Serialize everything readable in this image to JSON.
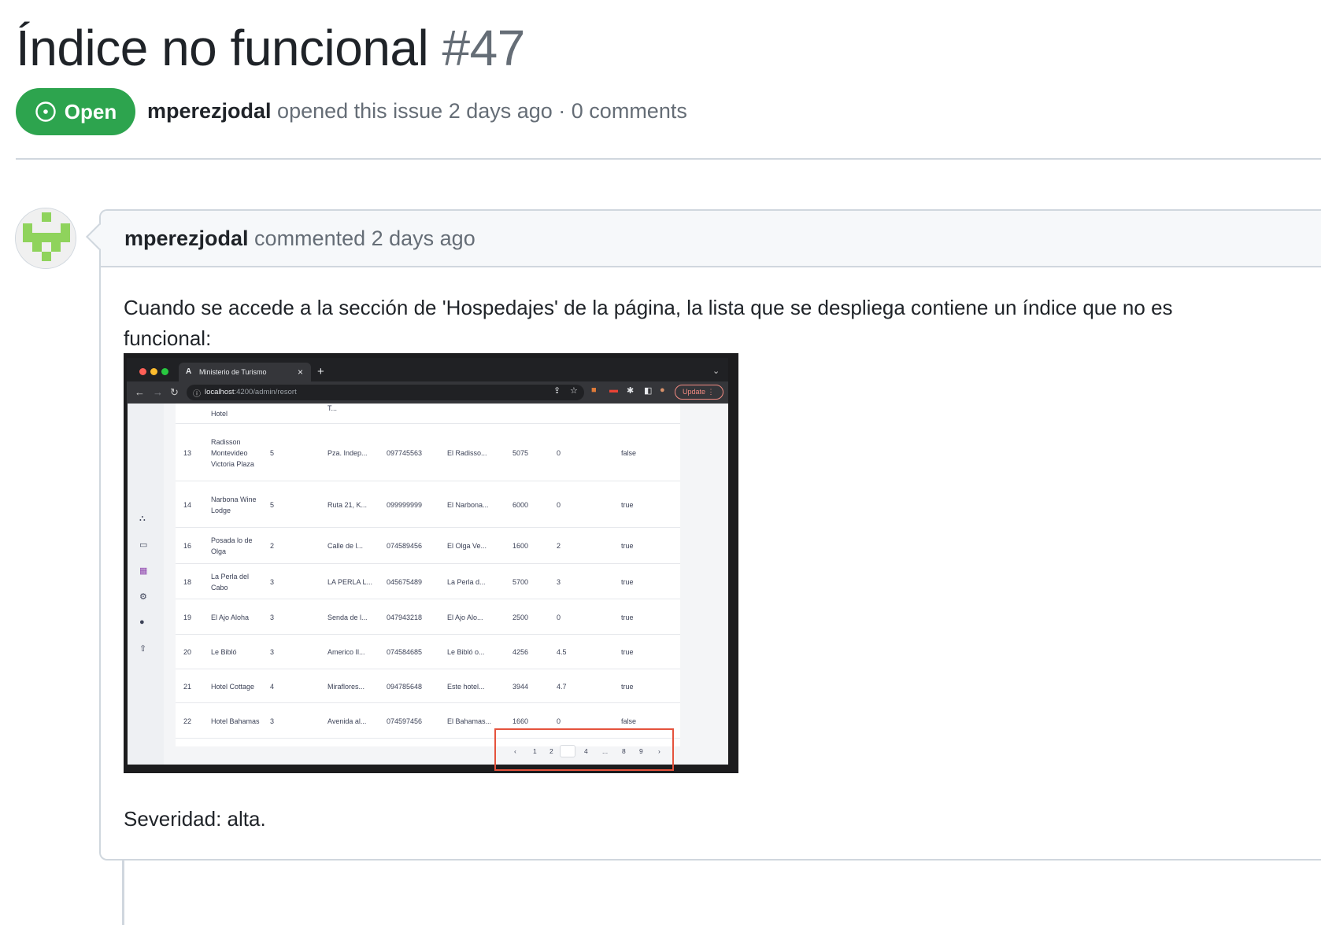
{
  "issue": {
    "title": "Índice no funcional",
    "number": "#47",
    "state": "Open",
    "author": "mperezjodal",
    "meta_text": " opened this issue 2 days ago · 0 comments"
  },
  "comment": {
    "author": "mperezjodal",
    "header_text": " commented 2 days ago",
    "body_text": "Cuando se accede a la sección de 'Hospedajes' de la página, la lista que se despliega contiene un índice que no es funcional:",
    "severity_text": "Severidad: alta."
  },
  "screenshot": {
    "tab_title": "Ministerio de Turismo",
    "url_host": "localhost",
    "url_path": ":4200/admin/resort",
    "update_label": "Update",
    "partial_row": {
      "name": "Hotel",
      "address": "T..."
    },
    "rows": [
      {
        "id": "13",
        "name": "Radisson Montevideo Victoria Plaza",
        "stars": "5",
        "address": "Pza. Indep...",
        "phone": "097745563",
        "description": "El Radisso...",
        "price": "5075",
        "rating": "0",
        "active": "false"
      },
      {
        "id": "14",
        "name": "Narbona Wine Lodge",
        "stars": "5",
        "address": "Ruta 21, K...",
        "phone": "099999999",
        "description": "El Narbona...",
        "price": "6000",
        "rating": "0",
        "active": "true"
      },
      {
        "id": "16",
        "name": "Posada lo de Olga",
        "stars": "2",
        "address": "Calle de l...",
        "phone": "074589456",
        "description": "El Olga Ve...",
        "price": "1600",
        "rating": "2",
        "active": "true"
      },
      {
        "id": "18",
        "name": "La Perla del Cabo",
        "stars": "3",
        "address": "LA PERLA L...",
        "phone": "045675489",
        "description": "La Perla d...",
        "price": "5700",
        "rating": "3",
        "active": "true"
      },
      {
        "id": "19",
        "name": "El Ajo Aloha",
        "stars": "3",
        "address": "Senda de l...",
        "phone": "047943218",
        "description": "El Ajo Alo...",
        "price": "2500",
        "rating": "0",
        "active": "true"
      },
      {
        "id": "20",
        "name": "Le Bibló",
        "stars": "3",
        "address": "Americo Il...",
        "phone": "074584685",
        "description": "Le Bibló o...",
        "price": "4256",
        "rating": "4.5",
        "active": "true"
      },
      {
        "id": "21",
        "name": "Hotel Cottage",
        "stars": "4",
        "address": "Miraflores...",
        "phone": "094785648",
        "description": "Este hotel...",
        "price": "3944",
        "rating": "4.7",
        "active": "true"
      },
      {
        "id": "22",
        "name": "Hotel Bahamas",
        "stars": "3",
        "address": "Avenida al...",
        "phone": "074597456",
        "description": "El Bahamas...",
        "price": "1660",
        "rating": "0",
        "active": "false"
      }
    ],
    "pagination": [
      "‹",
      "1",
      "2",
      "",
      "4",
      "...",
      "8",
      "9",
      "›"
    ],
    "colors": {
      "red_highlight": "#e5533d",
      "badge_green": "#2da44e",
      "avatar_green": "#8fd35c"
    }
  }
}
